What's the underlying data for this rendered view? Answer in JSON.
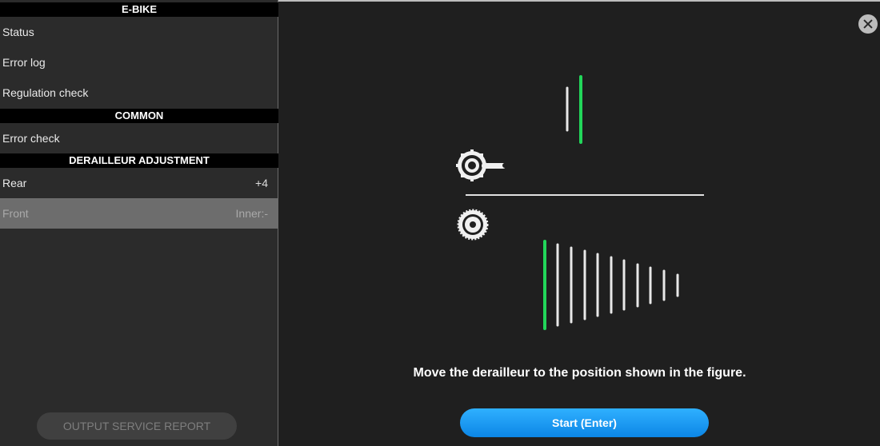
{
  "sidebar": {
    "sections": [
      {
        "header": "E-BIKE",
        "items": [
          {
            "label": "Status",
            "value": ""
          },
          {
            "label": "Error log",
            "value": ""
          },
          {
            "label": "Regulation check",
            "value": ""
          }
        ]
      },
      {
        "header": "COMMON",
        "items": [
          {
            "label": "Error check",
            "value": ""
          }
        ]
      },
      {
        "header": "DERAILLEUR ADJUSTMENT",
        "items": [
          {
            "label": "Rear",
            "value": "+4"
          },
          {
            "label": "Front",
            "value": "Inner:-"
          }
        ]
      }
    ],
    "report_button": "OUTPUT SERVICE REPORT"
  },
  "main": {
    "instruction": "Move the derailleur to the position shown in the figure.",
    "start_button": "Start  (Enter)"
  },
  "colors": {
    "active_gear": "#22d65a",
    "gear_line": "#e8e8e8",
    "start_button": "#1a9cf5"
  },
  "icons": {
    "close": "close-icon",
    "chainring": "chainring-icon",
    "cassette": "cassette-icon"
  }
}
